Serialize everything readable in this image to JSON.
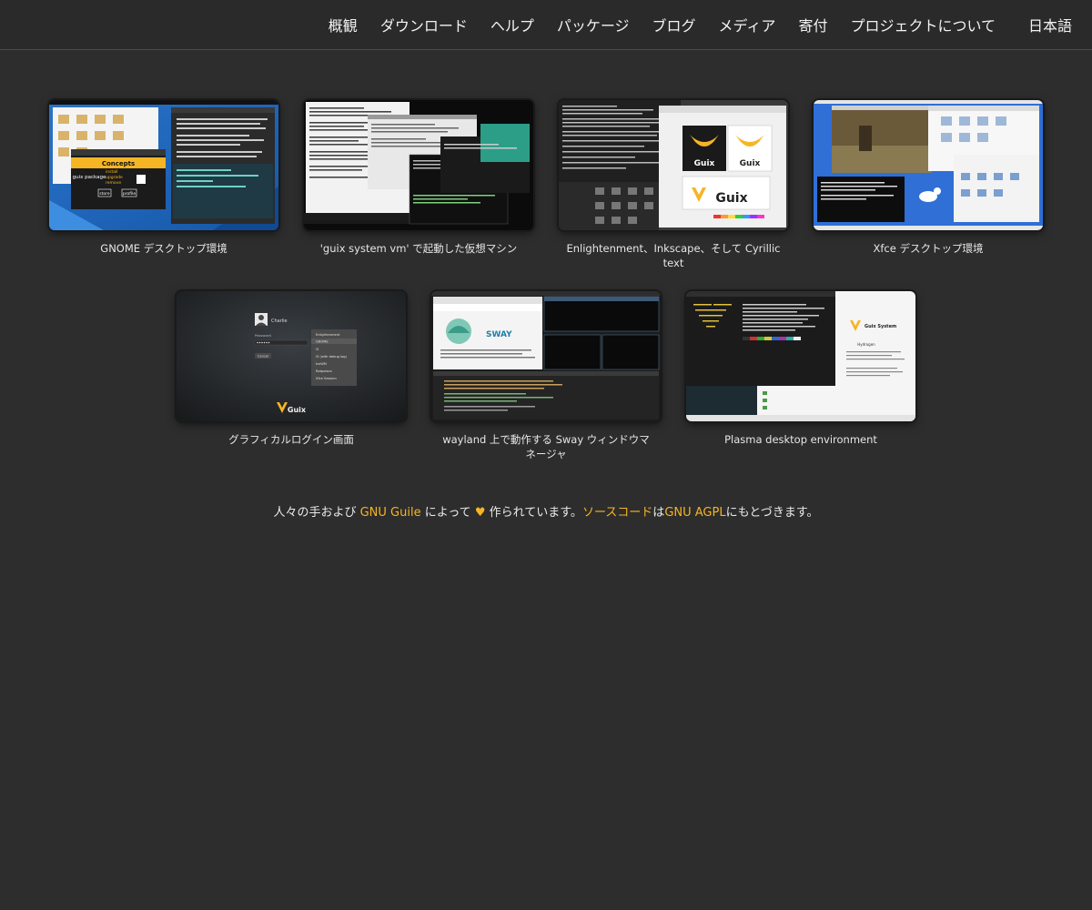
{
  "nav": {
    "items": [
      "概観",
      "ダウンロード",
      "ヘルプ",
      "パッケージ",
      "ブログ",
      "メディア",
      "寄付",
      "プロジェクトについて"
    ],
    "language": "日本語"
  },
  "screenshots": [
    {
      "caption": "GNOME デスクトップ環境"
    },
    {
      "caption": "'guix system vm' で起動した仮想マシン"
    },
    {
      "caption": "Enlightenment、Inkscape、そして Cyrillic text"
    },
    {
      "caption": "Xfce デスクトップ環境"
    },
    {
      "caption": "グラフィカルログイン画面"
    },
    {
      "caption": "wayland 上で動作する Sway ウィンドウマネージャ"
    },
    {
      "caption": "Plasma desktop environment"
    }
  ],
  "thumb_text": {
    "concepts": "Concepts",
    "guix_package": "guix package",
    "install": "install",
    "upgrade": "upgrade",
    "remove": "remove",
    "store": "store",
    "profile": "profile",
    "guix": "Guix",
    "sway": "SWAY",
    "login_user": "Charlie",
    "login_password": "Password",
    "login_cancel": "Cancel",
    "sessions": [
      "Enlightenment",
      "GNOME",
      "i3",
      "i3 (with debug log)",
      "IceWM",
      "Ratpoison",
      "Xfce Session"
    ],
    "plasma_title": "Guix System",
    "plasma_sub": "Hydrogen"
  },
  "footer": {
    "prefix": "人々の手および ",
    "guile": "GNU Guile",
    "middle": " によって ",
    "heart": "♥",
    "built": " 作られています。",
    "source": "ソースコード",
    "ha": "は",
    "license": "GNU AGPL",
    "suffix": "にもとづきます。"
  },
  "colors": {
    "background": "#2d2d2d",
    "accent": "#f6b524"
  }
}
